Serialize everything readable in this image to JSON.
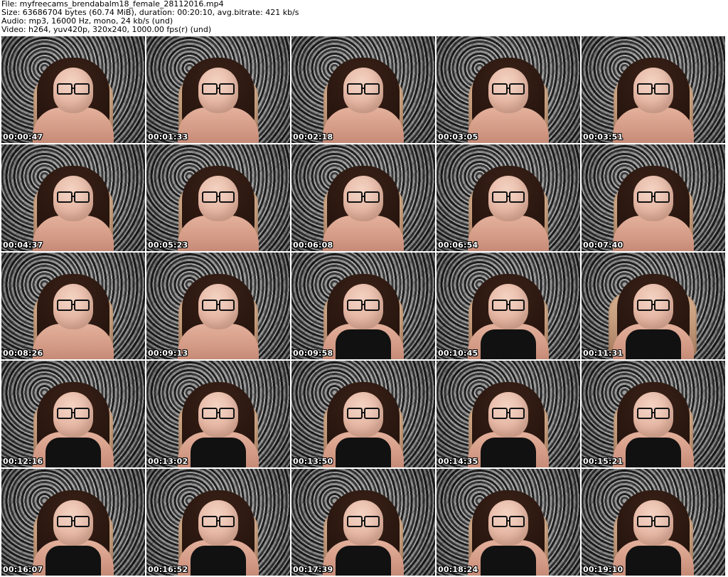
{
  "header": {
    "file_line": "File: myfreecams_brendabalm18_female_28112016.mp4",
    "size_line": "Size: 63686704 bytes (60.74 MiB), duration: 00:20:10, avg.bitrate: 421 kb/s",
    "audio_line": "Audio: mp3, 16000 Hz, mono, 24 kb/s (und)",
    "video_line": "Video: h264, yuv420p, 320x240, 1000.00 fps(r) (und)"
  },
  "thumbnails": [
    {
      "time": "00:00:47"
    },
    {
      "time": "00:01:33"
    },
    {
      "time": "00:02:18"
    },
    {
      "time": "00:03:05"
    },
    {
      "time": "00:03:51"
    },
    {
      "time": "00:04:37"
    },
    {
      "time": "00:05:23"
    },
    {
      "time": "00:06:08"
    },
    {
      "time": "00:06:54"
    },
    {
      "time": "00:07:40"
    },
    {
      "time": "00:08:26"
    },
    {
      "time": "00:09:13"
    },
    {
      "time": "00:09:58"
    },
    {
      "time": "00:10:45"
    },
    {
      "time": "00:11:31"
    },
    {
      "time": "00:12:16"
    },
    {
      "time": "00:13:02"
    },
    {
      "time": "00:13:50"
    },
    {
      "time": "00:14:35"
    },
    {
      "time": "00:15:21"
    },
    {
      "time": "00:16:07"
    },
    {
      "time": "00:16:52"
    },
    {
      "time": "00:17:39"
    },
    {
      "time": "00:18:24"
    },
    {
      "time": "00:19:10"
    }
  ]
}
